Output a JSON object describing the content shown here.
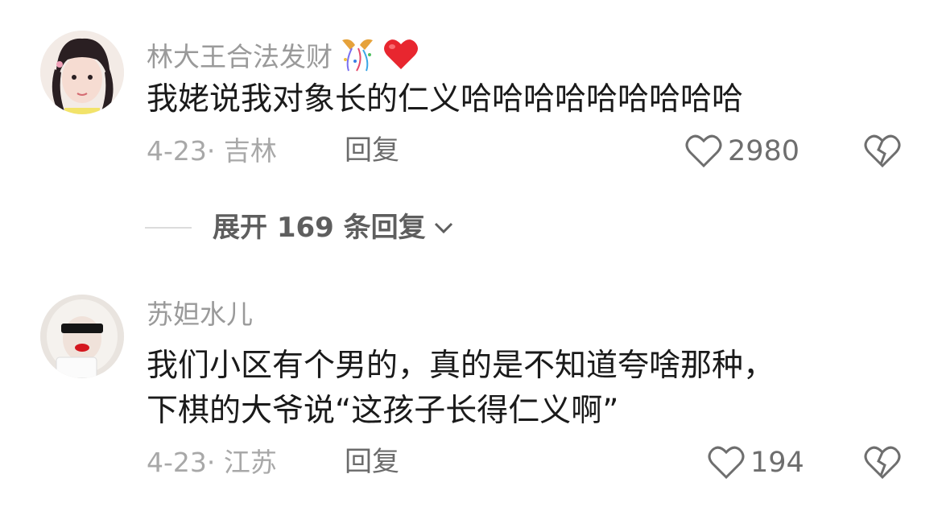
{
  "comments": [
    {
      "username": "林大王合法发财",
      "username_emojis": [
        "party-popper-icon",
        "red-heart-icon"
      ],
      "text_lines": [
        "我姥说我对象长的仁义哈哈哈哈哈哈哈哈哈"
      ],
      "date_location": "4-23· 吉林",
      "reply_label": "回复",
      "like_count": "2980"
    },
    {
      "username": "苏妲水儿",
      "username_emojis": [],
      "text_lines": [
        "我们小区有个男的，真的是不知道夸啥那种，",
        "下棋的大爷说“这孩子长得仁义啊”"
      ],
      "date_location": "4-23· 江苏",
      "reply_label": "回复",
      "like_count": "194"
    }
  ],
  "expand_replies": {
    "label": "展开 169 条回复"
  },
  "colors": {
    "username": "#9a9a9a",
    "text": "#1a1a1a",
    "meta": "#a8a8a8",
    "heart_emoji": "#e8262f"
  }
}
